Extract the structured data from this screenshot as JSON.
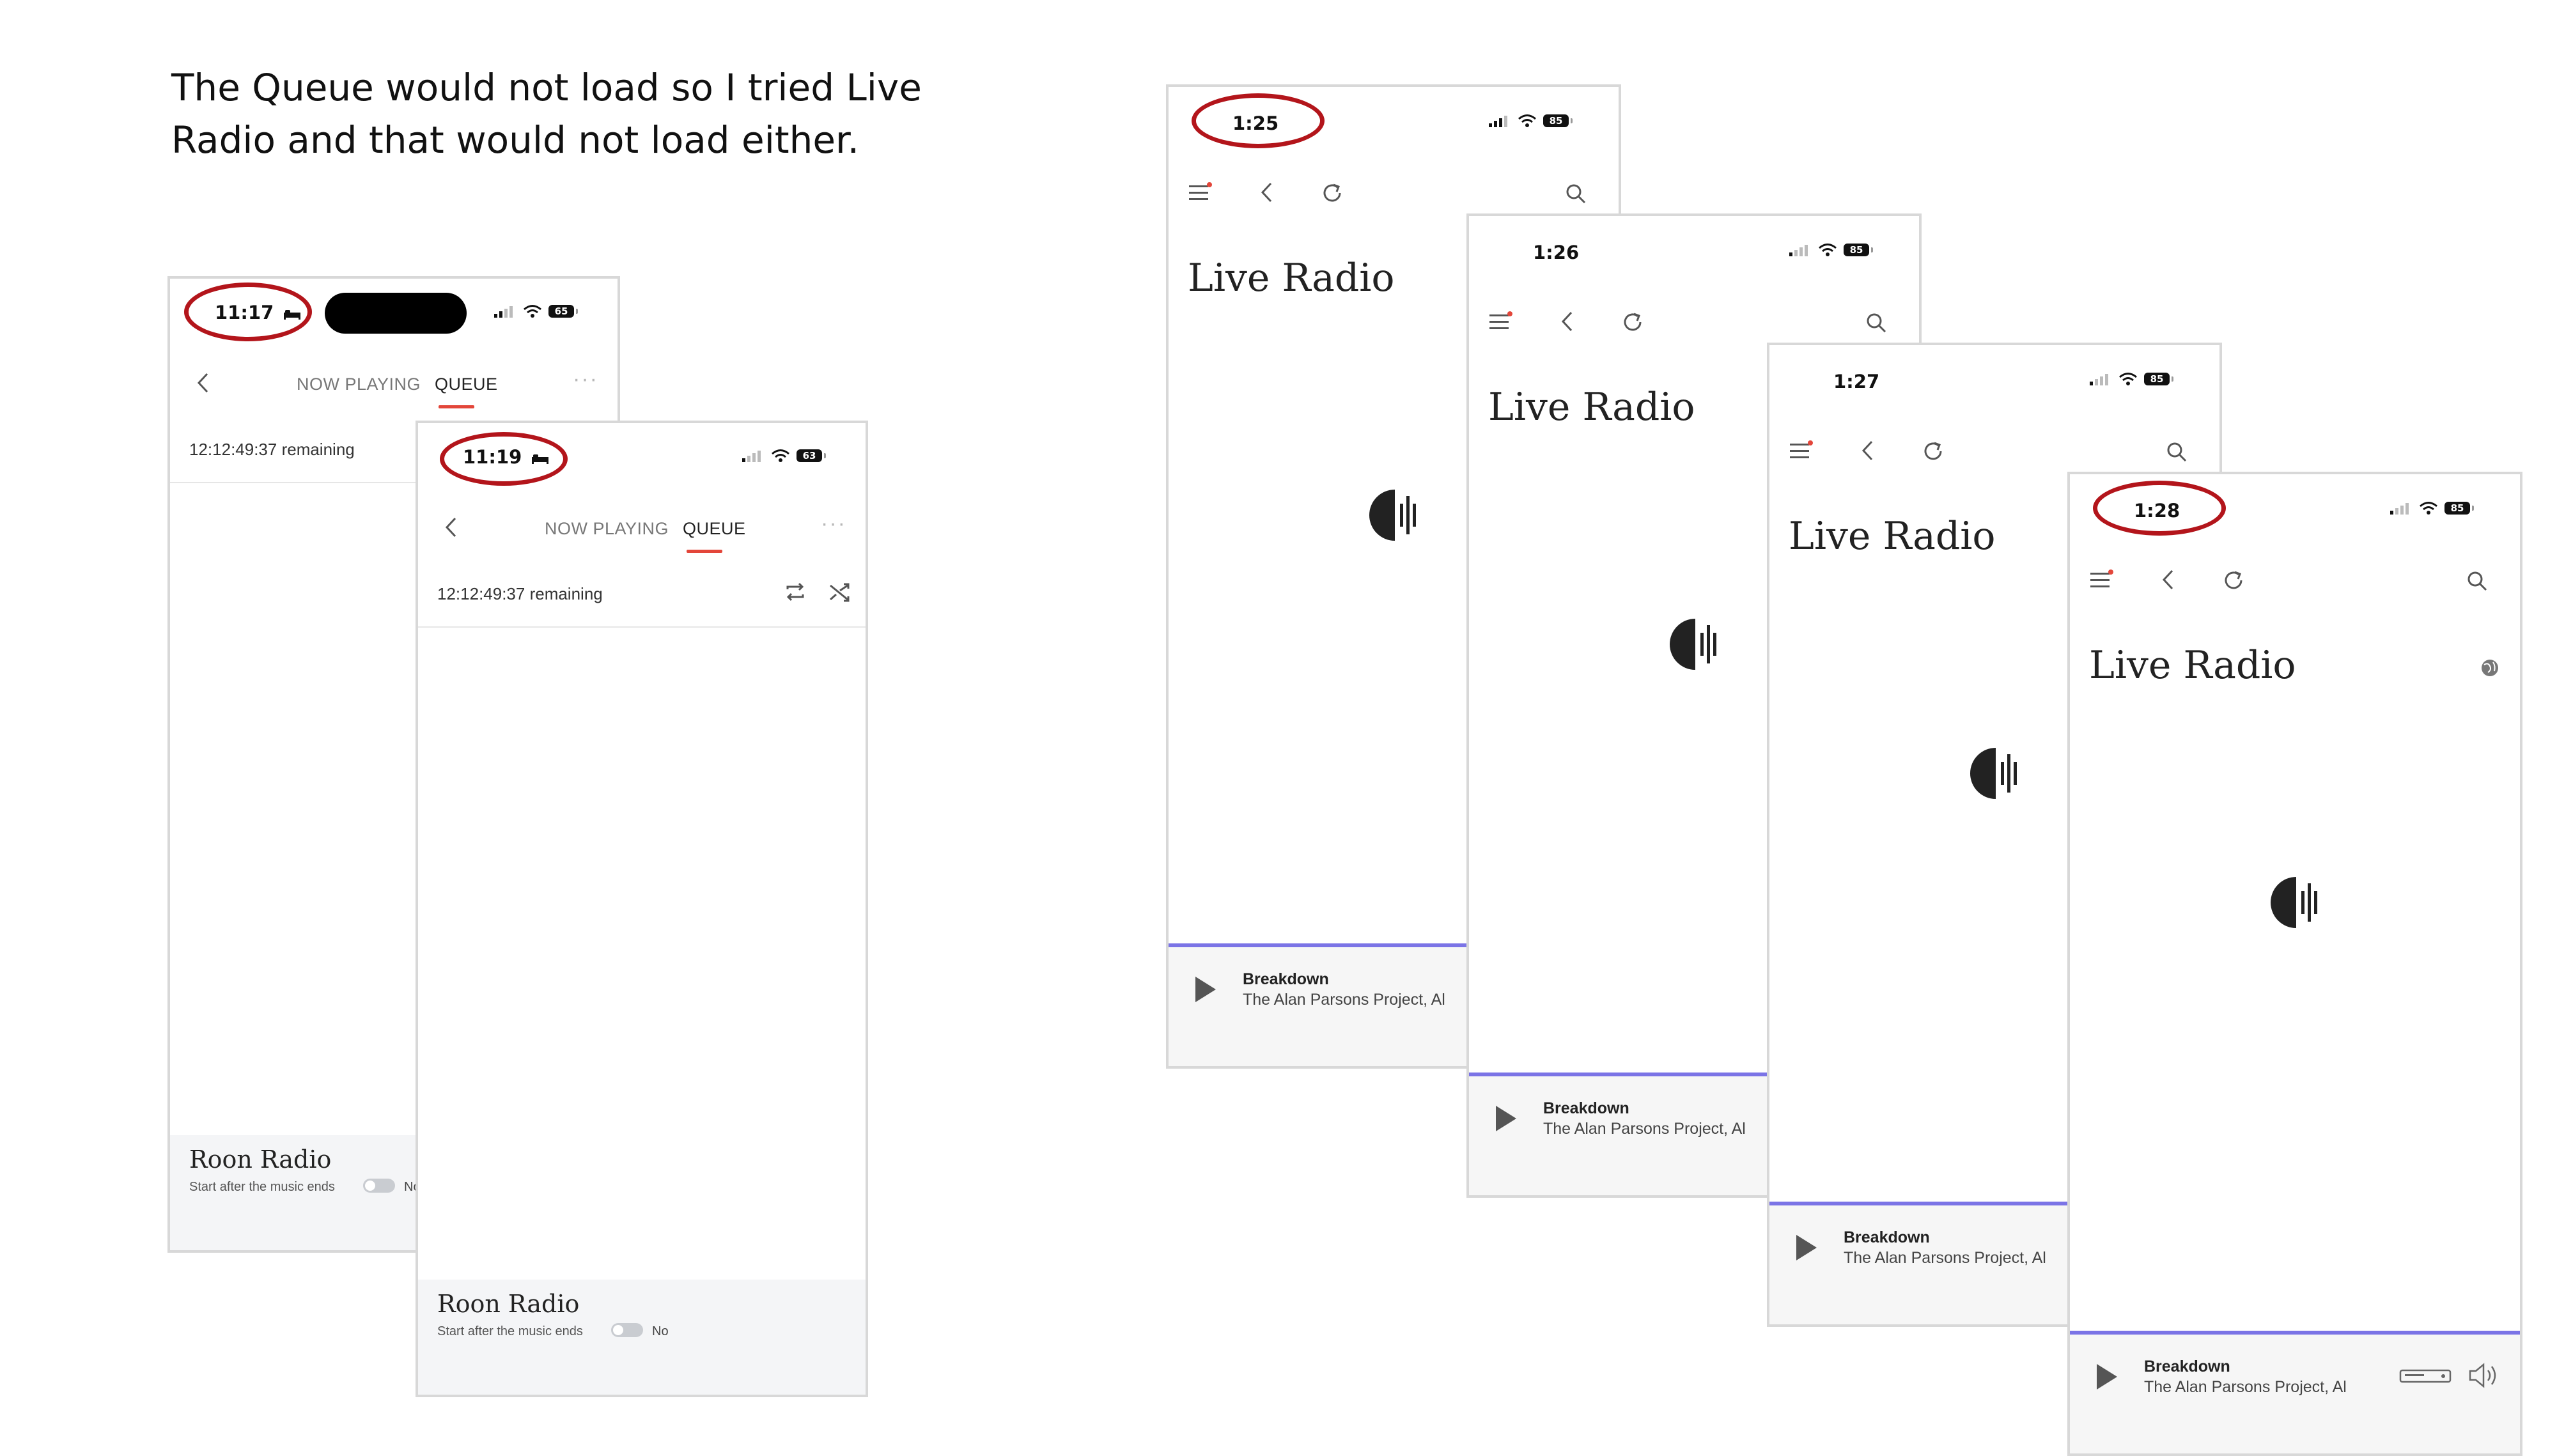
{
  "caption": "The Queue would not load so I tried Live Radio and that would not load either.",
  "queue_screens": [
    {
      "time": "11:17",
      "battery": "65",
      "tabs": {
        "now_playing": "NOW PLAYING",
        "queue": "QUEUE"
      },
      "remaining": "12:12:49:37 remaining",
      "roon_radio": {
        "title": "Roon Radio",
        "subtitle": "Start after the music ends",
        "toggle_label": "No"
      }
    },
    {
      "time": "11:19",
      "battery": "63",
      "tabs": {
        "now_playing": "NOW PLAYING",
        "queue": "QUEUE"
      },
      "remaining": "12:12:49:37 remaining",
      "roon_radio": {
        "title": "Roon Radio",
        "subtitle": "Start after the music ends",
        "toggle_label": "No"
      }
    }
  ],
  "radio_screens": [
    {
      "time": "1:25",
      "battery": "85",
      "title": "Live Radio",
      "track": "Breakdown",
      "artist": "The Alan Parsons Project, Al"
    },
    {
      "time": "1:26",
      "battery": "85",
      "title": "Live Radio",
      "track": "Breakdown",
      "artist": "The Alan Parsons Project, Al"
    },
    {
      "time": "1:27",
      "battery": "85",
      "title": "Live Radio",
      "track": "Breakdown",
      "artist": "The Alan Parsons Project, Al"
    },
    {
      "time": "1:28",
      "battery": "85",
      "title": "Live Radio",
      "track": "Breakdown",
      "artist": "The Alan Parsons Project, Al"
    }
  ],
  "colors": {
    "highlight_oval": "#b3151b",
    "queue_tab_underline": "#e3463a",
    "now_playing_progress": "#7b74e6"
  },
  "icons": {
    "back": "chevron-left-icon",
    "menu": "hamburger-menu-icon",
    "refresh": "refresh-icon",
    "search": "search-icon",
    "loading": "roon-loading-icon",
    "play": "play-icon",
    "repeat": "repeat-icon",
    "shuffle": "shuffle-icon",
    "globe": "globe-icon",
    "device": "device-icon",
    "volume": "volume-icon"
  }
}
